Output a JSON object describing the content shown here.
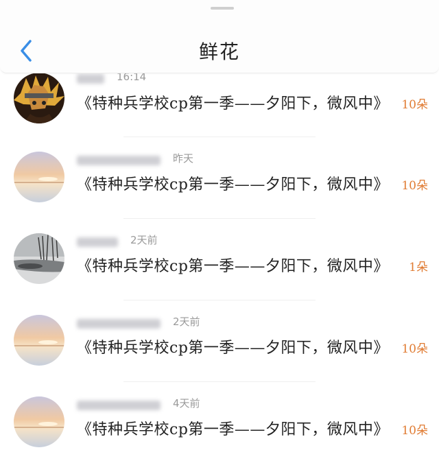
{
  "header": {
    "title": "鲜花",
    "back_icon": "chevron-left-icon"
  },
  "colors": {
    "accent": "#3a8ee6",
    "count": "#e07b32"
  },
  "items": [
    {
      "time": "16:14",
      "work": "《特种兵学校cp第一季——夕阳下，微风中》",
      "count": "10朵"
    },
    {
      "time": "昨天",
      "work": "《特种兵学校cp第一季——夕阳下，微风中》",
      "count": "10朵"
    },
    {
      "time": "2天前",
      "work": "《特种兵学校cp第一季——夕阳下，微风中》",
      "count": "1朵"
    },
    {
      "time": "2天前",
      "work": "《特种兵学校cp第一季——夕阳下，微风中》",
      "count": "10朵"
    },
    {
      "time": "4天前",
      "work": "《特种兵学校cp第一季——夕阳下，微风中》",
      "count": "10朵"
    }
  ]
}
